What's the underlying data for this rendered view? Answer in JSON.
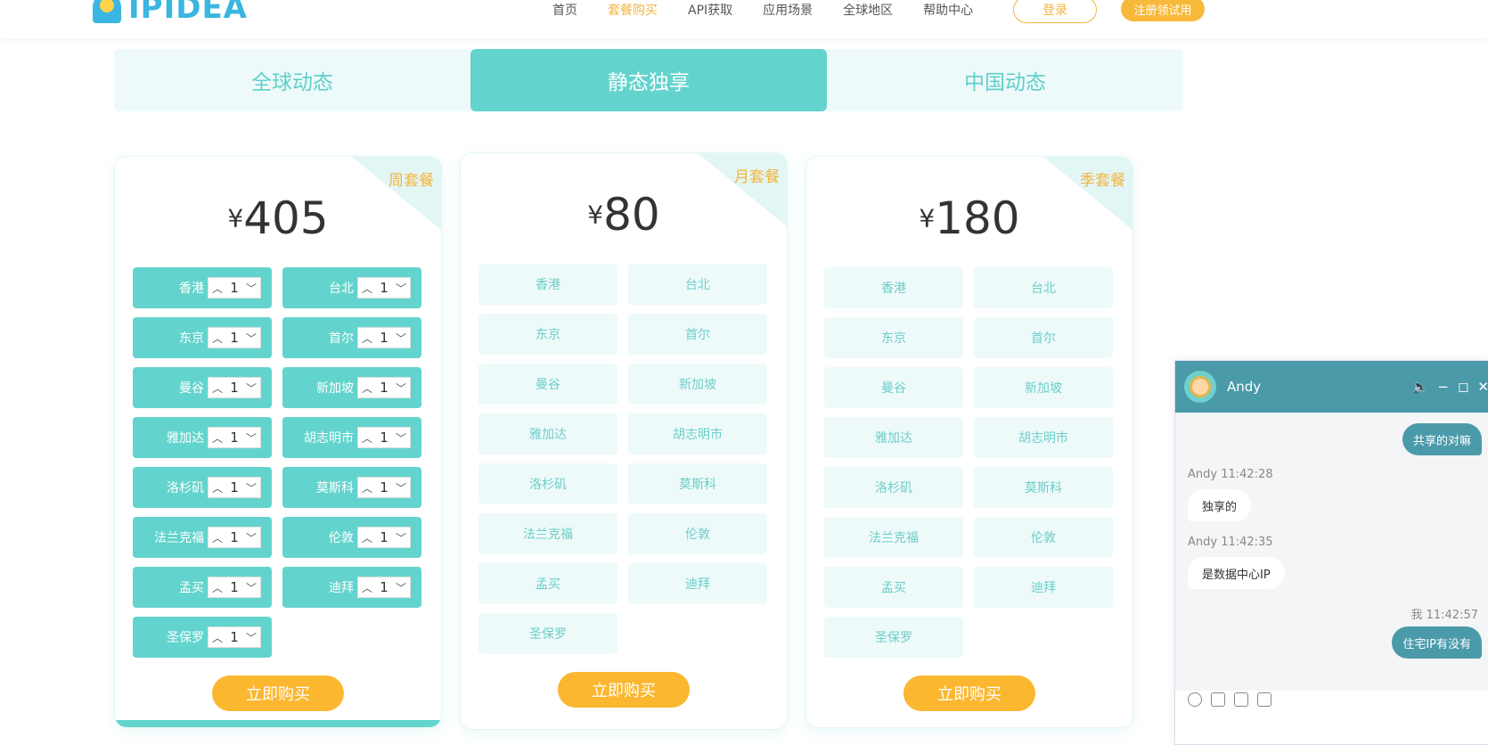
{
  "header": {
    "logo_text": "IPIDEA",
    "nav": [
      "首页",
      "套餐购买",
      "API获取",
      "应用场景",
      "全球地区",
      "帮助中心"
    ],
    "nav_active_index": 1,
    "login_label": "登录",
    "register_label": "注册领试用"
  },
  "tabs": [
    "全球动态",
    "静态独享",
    "中国动态"
  ],
  "tabs_active_index": 1,
  "cities": [
    "香港",
    "台北",
    "东京",
    "首尔",
    "曼谷",
    "新加坡",
    "雅加达",
    "胡志明市",
    "洛杉矶",
    "莫斯科",
    "法兰克福",
    "伦敦",
    "孟买",
    "迪拜",
    "圣保罗"
  ],
  "cards": [
    {
      "label": "周套餐",
      "currency": "¥",
      "price": "405",
      "stepper_qty": "1",
      "buy_label": "立即购买"
    },
    {
      "label": "月套餐",
      "currency": "¥",
      "price": "80",
      "buy_label": "立即购买"
    },
    {
      "label": "季套餐",
      "currency": "¥",
      "price": "180",
      "buy_label": "立即购买"
    }
  ],
  "chat": {
    "agent_name": "Andy",
    "messages": [
      {
        "side": "right",
        "text": "共享的对嘛"
      },
      {
        "side": "left",
        "meta": "Andy 11:42:28",
        "text": "独享的"
      },
      {
        "side": "left",
        "meta": "Andy 11:42:35",
        "text": "是数据中心IP"
      },
      {
        "side": "right",
        "meta": "我 11:42:57",
        "text": "住宅IP有没有"
      }
    ]
  },
  "colors": {
    "accent": "#63d4cd",
    "orange": "#fbb72f",
    "chat_header": "#4a9aaa"
  }
}
